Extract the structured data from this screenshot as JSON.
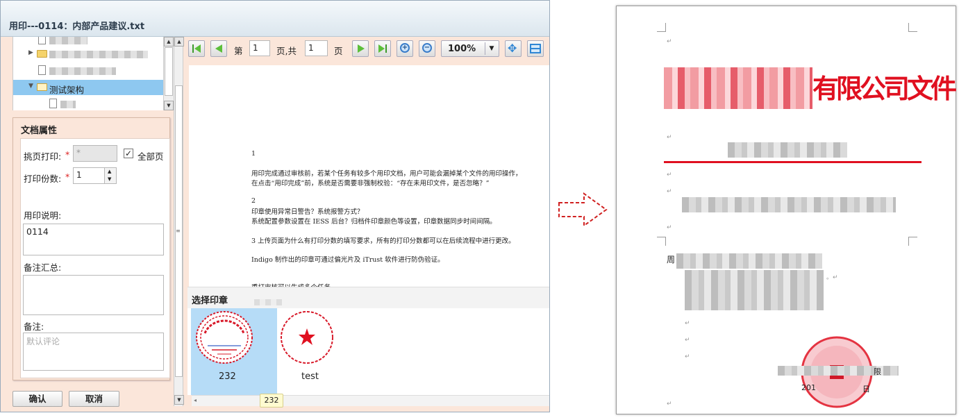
{
  "window": {
    "title": "用印---0114：内部产品建议.txt"
  },
  "tree": {
    "items": [
      {
        "label": "测试架构"
      }
    ]
  },
  "props": {
    "title": "文档属性",
    "page_print_label": "挑页打印:",
    "page_print_value": "*",
    "all_pages_label": "全部页",
    "copies_label": "打印份数:",
    "copies_value": "1",
    "usage_label": "用印说明:",
    "usage_value": "0114",
    "remarks_summary_label": "备注汇总:",
    "remark_label": "备注:",
    "remark_placeholder": "默认评论"
  },
  "buttons": {
    "confirm": "确认",
    "cancel": "取消"
  },
  "toolbar": {
    "page_prefix": "第",
    "current_page": "1",
    "page_mid": "页,共",
    "total_pages": "1",
    "page_suffix": "页",
    "zoom": "100%"
  },
  "document": {
    "lines": [
      "1",
      "用印完成通过审核前，若某个任务有较多个用印文档，用户可能会漏掉某个文件的用印操作，",
      "在点击“用印完成”前，系统是否需要非强制校验：“存在未用印文件，是否忽略？”",
      "2",
      "印章使用异常日警告？系统报警方式？",
      "系统配置参数设置在 IESS 后台？归档件印章颜色等设置，印章数据同步时间间隔。",
      "3 上传页面为什么有打印分数的填写要求，所有的打印分数都可以在后续流程中进行更改。",
      "Indigo 制作出的印章可通过偏光片及 iTrust 软件进行防伪验证。",
      "重打审核可以生成多个任务。"
    ]
  },
  "seals": {
    "header": "选择印章",
    "items": [
      {
        "name": "232"
      },
      {
        "name": "test"
      }
    ],
    "tooltip": "232"
  },
  "preview": {
    "heading_suffix": "有限公司文件",
    "addressee_prefix": "周",
    "date_prefix": "201",
    "date_suffix": "日",
    "sign_suffix": "限"
  },
  "colors": {
    "accent_red": "#e01020",
    "selection_blue": "#b6dcf7",
    "panel_bg": "#fbe6da"
  }
}
